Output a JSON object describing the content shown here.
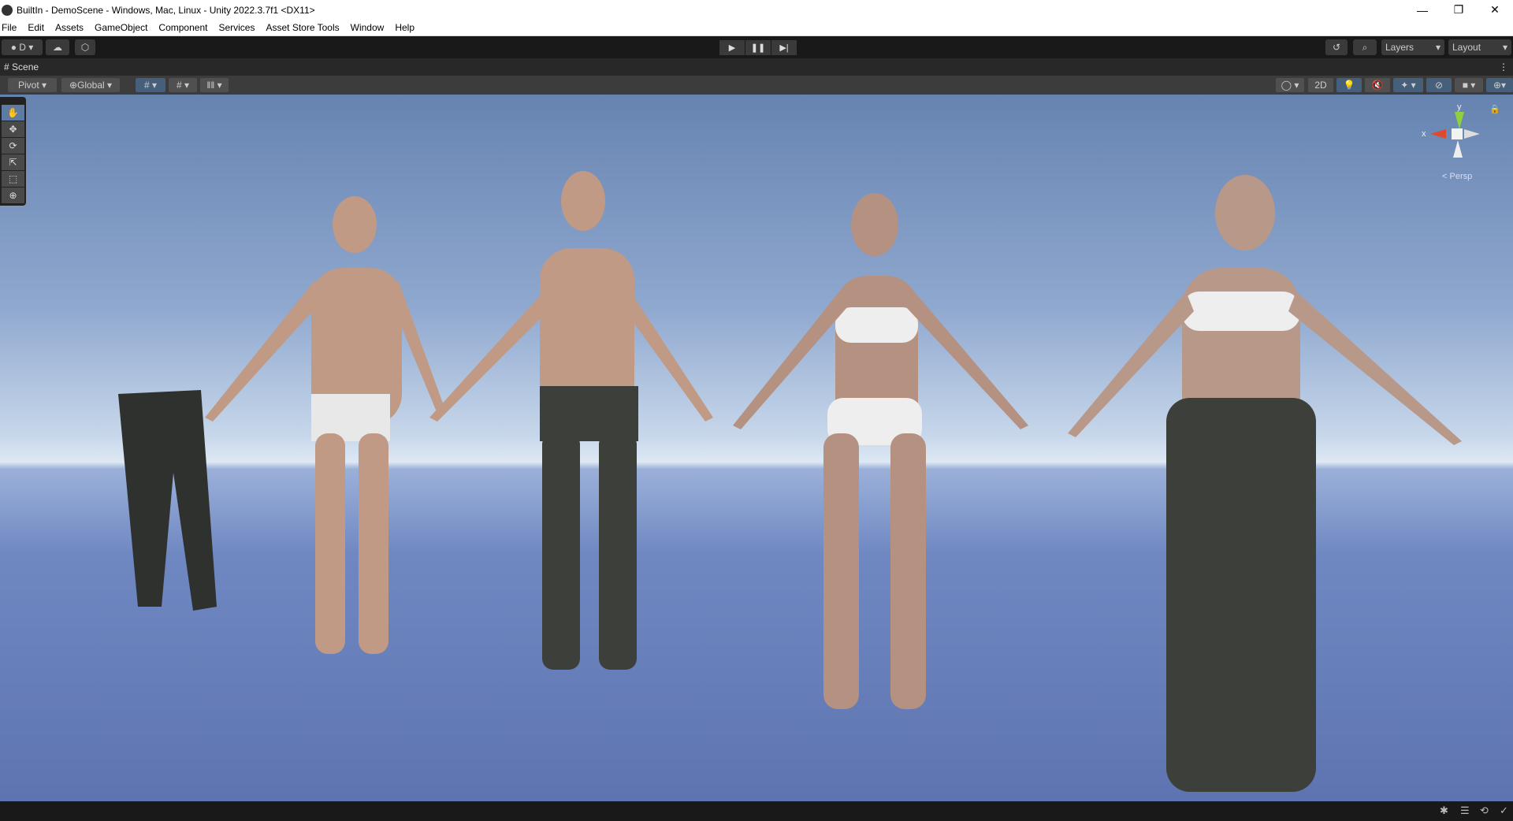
{
  "window": {
    "title": "BuiltIn - DemoScene - Windows, Mac, Linux - Unity 2022.3.7f1 <DX11>",
    "minimize": "—",
    "maximize": "❐",
    "close": "✕"
  },
  "menu": [
    "File",
    "Edit",
    "Assets",
    "GameObject",
    "Component",
    "Services",
    "Asset Store Tools",
    "Window",
    "Help"
  ],
  "toolbar": {
    "account": "D",
    "layers": "Layers",
    "layout": "Layout"
  },
  "scene": {
    "tab": "Scene",
    "pivot": "Pivot",
    "global": "Global",
    "mode_2d": "2D",
    "persp": "Persp",
    "axis_x": "x",
    "axis_y": "y"
  },
  "colors": {
    "accent": "#46607c",
    "sky": "#8fa8cf",
    "ground": "#6b83bf"
  }
}
